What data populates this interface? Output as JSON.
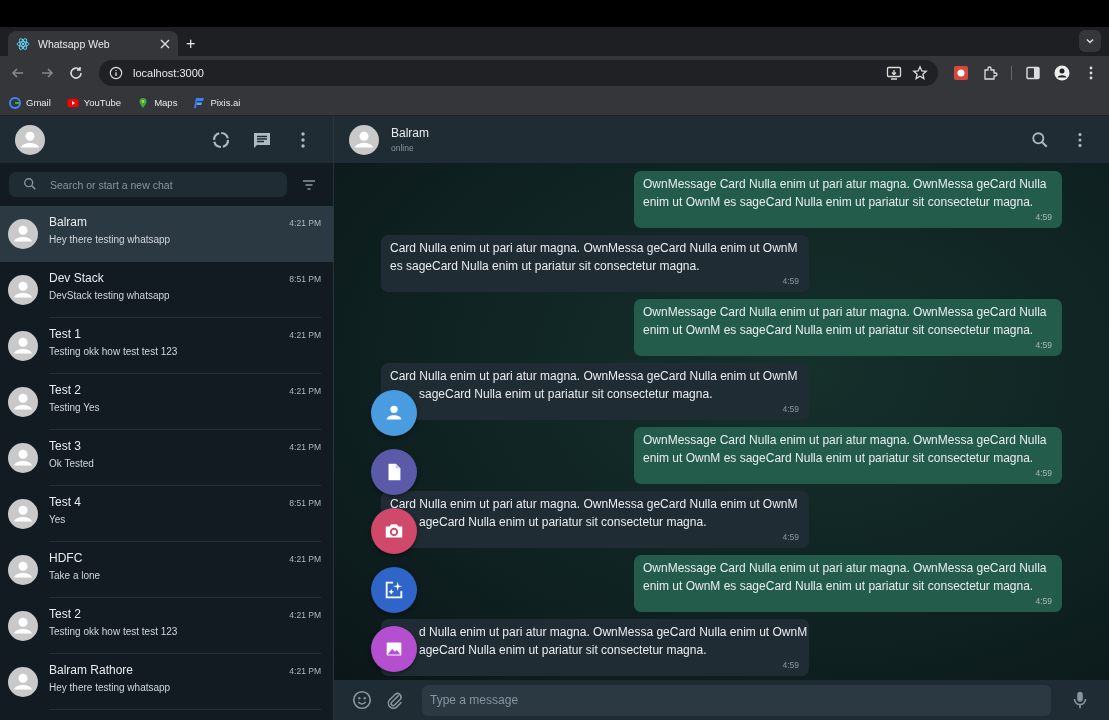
{
  "browser": {
    "tab_title": "Whatsapp Web",
    "new_tab": "+",
    "url": "localhost:3000",
    "bookmarks": [
      {
        "label": "Gmail",
        "kind": "gmail"
      },
      {
        "label": "YouTube",
        "kind": "youtube"
      },
      {
        "label": "Maps",
        "kind": "maps"
      },
      {
        "label": "Pixis.ai",
        "kind": "pixis"
      }
    ]
  },
  "sidebar": {
    "search": {
      "placeholder": "Search or start a new chat"
    },
    "chats": [
      {
        "name": "Balram",
        "message": "Hey there testing whatsapp",
        "time": "4:21 PM",
        "selected": true
      },
      {
        "name": "Dev Stack",
        "message": "DevStack testing whatsapp",
        "time": "8:51 PM",
        "selected": false
      },
      {
        "name": "Test 1",
        "message": "Testing okk how test test 123",
        "time": "4:21 PM",
        "selected": false
      },
      {
        "name": "Test 2",
        "message": "Testing Yes",
        "time": "4:21 PM",
        "selected": false
      },
      {
        "name": "Test 3",
        "message": "Ok Tested",
        "time": "4:21 PM",
        "selected": false
      },
      {
        "name": "Test 4",
        "message": "Yes",
        "time": "8:51 PM",
        "selected": false
      },
      {
        "name": "HDFC",
        "message": "Take a lone",
        "time": "4:21 PM",
        "selected": false
      },
      {
        "name": "Test 2",
        "message": "Testing okk how test test 123",
        "time": "4:21 PM",
        "selected": false
      },
      {
        "name": "Balram Rathore",
        "message": "Hey there testing whatsapp",
        "time": "4:21 PM",
        "selected": false
      }
    ]
  },
  "chat": {
    "contact": {
      "name": "Balram",
      "status": "online"
    },
    "messages": [
      {
        "kind": "outgoing",
        "lines": [
          {
            "text": "OwnMessage Card Nulla enim ut pari atur magna. OwnMessa geCard Nulla",
            "covered": false
          },
          {
            "text": "enim ut OwnM es sageCard Nulla enim ut pariatur sit consectetur magna.",
            "covered": false
          }
        ],
        "time": "4:59"
      },
      {
        "kind": "incoming",
        "lines": [
          {
            "text": "Card Nulla enim ut pari atur magna. OwnMessa geCard Nulla enim ut OwnM",
            "covered": false
          },
          {
            "text": "es sageCard Nulla enim ut pariatur sit consectetur magna.",
            "covered": false
          }
        ],
        "time": "4:59"
      },
      {
        "kind": "outgoing",
        "lines": [
          {
            "text": "OwnMessage Card Nulla enim ut pari atur magna. OwnMessa geCard Nulla",
            "covered": false
          },
          {
            "text": "enim ut OwnM es sageCard Nulla enim ut pariatur sit consectetur magna.",
            "covered": false
          }
        ],
        "time": "4:59"
      },
      {
        "kind": "incoming",
        "lines": [
          {
            "text": "Card Nulla enim ut pari atur magna. OwnMessa geCard Nulla enim ut OwnM",
            "covered": false
          },
          {
            "text": "sageCard Nulla enim ut pariatur sit consectetur magna.",
            "covered": true
          }
        ],
        "time": "4:59"
      },
      {
        "kind": "outgoing",
        "lines": [
          {
            "text": "OwnMessage Card Nulla enim ut pari atur magna. OwnMessa geCard Nulla",
            "covered": false
          },
          {
            "text": "enim ut OwnM es sageCard Nulla enim ut pariatur sit consectetur magna.",
            "covered": false
          }
        ],
        "time": "4:59"
      },
      {
        "kind": "incoming",
        "lines": [
          {
            "text": "Card Nulla enim ut pari atur magna. OwnMessa geCard Nulla enim ut OwnM",
            "covered": false
          },
          {
            "text": "ageCard Nulla enim ut pariatur sit consectetur magna.",
            "covered": true
          }
        ],
        "time": "4:59"
      },
      {
        "kind": "outgoing",
        "lines": [
          {
            "text": "OwnMessage Card Nulla enim ut pari atur magna. OwnMessa geCard Nulla",
            "covered": false
          },
          {
            "text": "enim ut OwnM es sageCard Nulla enim ut pariatur sit consectetur magna.",
            "covered": false
          }
        ],
        "time": "4:59"
      },
      {
        "kind": "incoming",
        "lines": [
          {
            "text": "d Nulla enim ut pari atur magna. OwnMessa geCard Nulla enim ut OwnM",
            "covered": true
          },
          {
            "text": "ageCard Nulla enim ut pariatur sit consectetur magna.",
            "covered": true
          }
        ],
        "time": "4:59"
      }
    ],
    "attach_menu": [
      {
        "kind": "contact",
        "color": "#4a9ce0"
      },
      {
        "kind": "document",
        "color": "#5a5aa8"
      },
      {
        "kind": "camera",
        "color": "#d0486a"
      },
      {
        "kind": "sticker",
        "color": "#2f64c8"
      },
      {
        "kind": "gallery",
        "color": "#b44fd0"
      }
    ],
    "composer": {
      "placeholder": "Type a message"
    }
  }
}
